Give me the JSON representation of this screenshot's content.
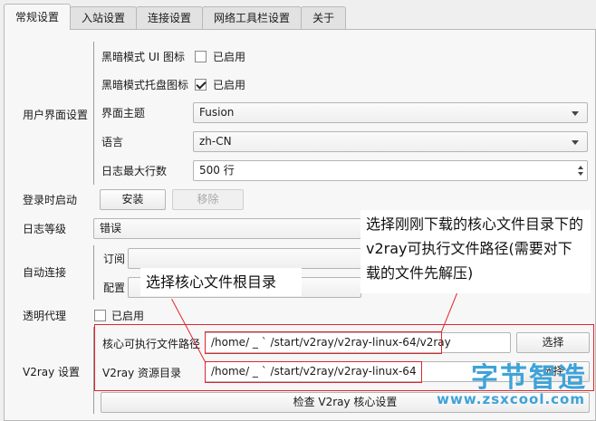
{
  "tabs": [
    {
      "label": "常规设置"
    },
    {
      "label": "入站设置"
    },
    {
      "label": "连接设置"
    },
    {
      "label": "网络工具栏设置"
    },
    {
      "label": "关于"
    }
  ],
  "ui_group": {
    "label": "用户界面设置",
    "dark_icon_label": "黑暗模式 UI 图标",
    "dark_icon_check": "已启用",
    "dark_tray_label": "黑暗模式托盘图标",
    "dark_tray_check": "已启用",
    "theme_label": "界面主题",
    "theme_value": "Fusion",
    "language_label": "语言",
    "language_value": "zh-CN",
    "max_lines_label": "日志最大行数",
    "max_lines_value": "500 行"
  },
  "login_start": {
    "label": "登录时启动",
    "install": "安装",
    "remove": "移除"
  },
  "log_level": {
    "label": "日志等级",
    "value": "错误"
  },
  "auto_connect": {
    "label": "自动连接",
    "subscription_label": "订阅",
    "config_label": "配置"
  },
  "transparent_proxy": {
    "label": "透明代理",
    "check": "已启用"
  },
  "v2ray": {
    "label": "V2ray 设置",
    "core_path_label": "核心可执行文件路径",
    "core_path_value": "/home/ _ ` /start/v2ray/v2ray-linux-64/v2ray",
    "core_select": "选择",
    "assets_label": "V2ray 资源目录",
    "assets_value": "/home/ _ ` /start/v2ray/v2ray-linux-64",
    "assets_select": "选择",
    "check_core": "检查 V2ray 核心设置"
  },
  "annotations": {
    "core_file": "选择刚刚下载的核心文件目录下的v2ray可执行文件路径(需要对下载的文件先解压)",
    "root_dir": "选择核心文件根目录"
  },
  "watermark": {
    "title": "字节智造",
    "url": "www.zsxcool.com"
  },
  "colors": {
    "annotation_red": "#e0262f",
    "watermark_blue": "#3ea3d8"
  }
}
